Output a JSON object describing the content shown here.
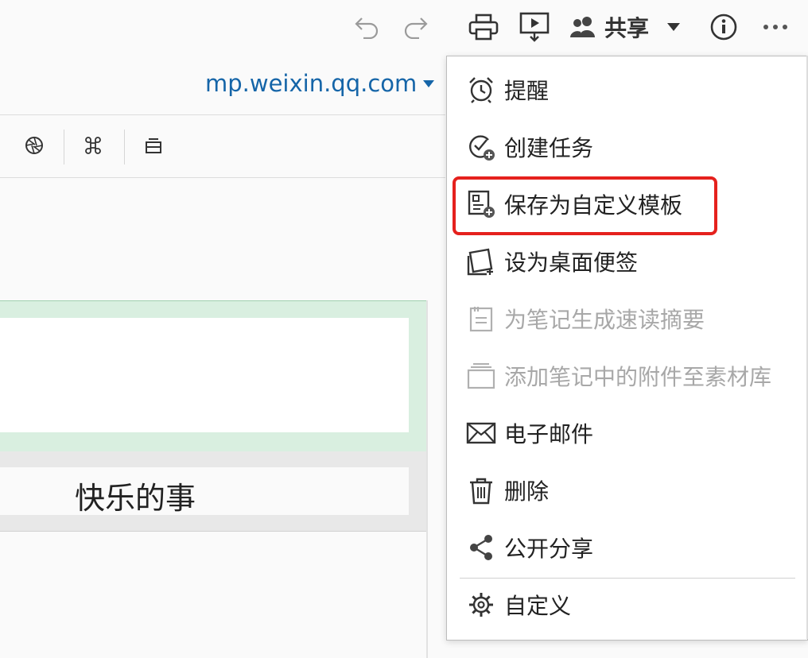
{
  "toolbar": {
    "undo_icon": "undo-icon",
    "redo_icon": "redo-icon",
    "print_icon": "print-icon",
    "present_icon": "present-icon",
    "share_label": "共享",
    "info_icon": "info-icon",
    "more_icon": "more-icon"
  },
  "domain": {
    "text": "mp.weixin.qq.com"
  },
  "format_bar": {
    "items": [
      "aperture-icon",
      "command-icon",
      "layout-icon"
    ]
  },
  "editor": {
    "cell_text": "快乐的事"
  },
  "menu": {
    "items": [
      {
        "label": "提醒",
        "icon": "alarm-clock-icon",
        "disabled": false
      },
      {
        "label": "创建任务",
        "icon": "task-add-icon",
        "disabled": false
      },
      {
        "label": "保存为自定义模板",
        "icon": "template-add-icon",
        "disabled": false,
        "highlighted": true
      },
      {
        "label": "设为桌面便签",
        "icon": "sticky-note-icon",
        "disabled": false
      },
      {
        "label": "为笔记生成速读摘要",
        "icon": "summary-icon",
        "disabled": true
      },
      {
        "label": "添加笔记中的附件至素材库",
        "icon": "attachment-library-icon",
        "disabled": true
      },
      {
        "label": "电子邮件",
        "icon": "mail-icon",
        "disabled": false
      },
      {
        "label": "删除",
        "icon": "trash-icon",
        "disabled": false
      },
      {
        "label": "公开分享",
        "icon": "share-icon",
        "disabled": false
      },
      {
        "label": "自定义",
        "icon": "gear-icon",
        "disabled": false
      }
    ]
  },
  "colors": {
    "accent": "#1565a8",
    "highlight": "#e5211d",
    "disabled_text": "#a8a8a8"
  }
}
